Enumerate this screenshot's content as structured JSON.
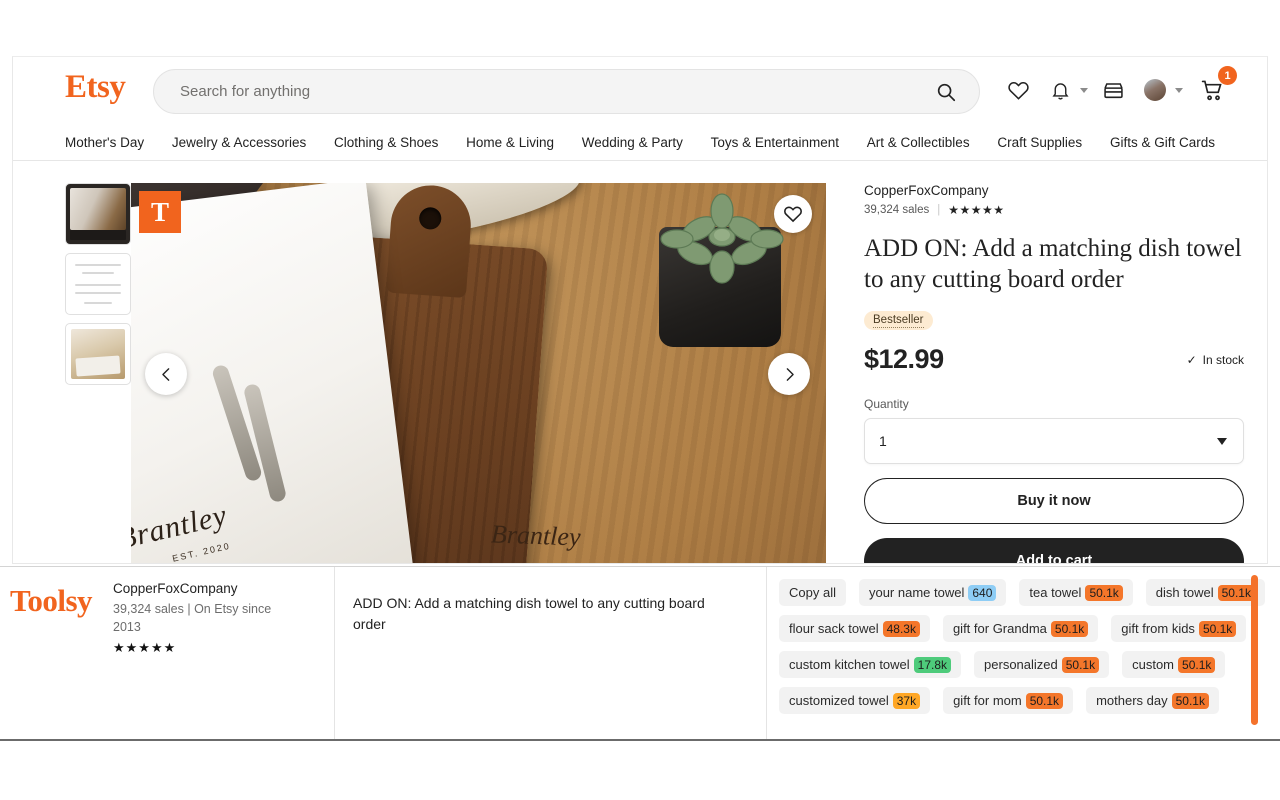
{
  "header": {
    "logo": "Etsy",
    "search_placeholder": "Search for anything",
    "search_value": "",
    "icons": {
      "search": "search-icon",
      "favorites": "heart-icon",
      "notifications": "bell-icon",
      "shop": "storefront-icon",
      "account": "avatar-icon",
      "cart": "cart-icon"
    },
    "cart_count": "1",
    "nav": [
      "Mother's Day",
      "Jewelry & Accessories",
      "Clothing & Shoes",
      "Home & Living",
      "Wedding & Party",
      "Toys & Entertainment",
      "Art & Collectibles",
      "Craft Supplies",
      "Gifts & Gift Cards"
    ]
  },
  "gallery": {
    "overlay_badge": "T",
    "favorite_icon": "heart-icon",
    "prev_icon": "chevron-left-icon",
    "next_icon": "chevron-right-icon",
    "towel_script": "Brantley",
    "towel_est": "EST. 2020",
    "board_script": "Brantley"
  },
  "listing": {
    "shop_name": "CopperFoxCompany",
    "sales": "39,324 sales",
    "divider": "|",
    "stars": "★★★★★",
    "title": "ADD ON: Add a matching dish towel to any cutting board order",
    "badge": "Bestseller",
    "price": "$12.99",
    "stock_check": "✓",
    "stock_text": "In stock",
    "quantity_label": "Quantity",
    "quantity_value": "1",
    "buy_now_label": "Buy it now",
    "add_to_cart_label": "Add to cart"
  },
  "toolsy": {
    "logo": "Toolsy",
    "shop_name": "CopperFoxCompany",
    "shop_meta": "39,324 sales | On Etsy since 2013",
    "stars": "★★★★★",
    "listing_title": "ADD ON: Add a matching dish towel to any cutting board order",
    "copy_all_label": "Copy all",
    "tags": [
      {
        "label": "your name towel",
        "count": "640",
        "color": "#8ecdf5"
      },
      {
        "label": "tea towel",
        "count": "50.1k",
        "color": "#f4762a"
      },
      {
        "label": "dish towel",
        "count": "50.1k",
        "color": "#f4762a"
      },
      {
        "label": "flour sack towel",
        "count": "48.3k",
        "color": "#f4762a"
      },
      {
        "label": "gift for Grandma",
        "count": "50.1k",
        "color": "#f4762a"
      },
      {
        "label": "gift from kids",
        "count": "50.1k",
        "color": "#f4762a"
      },
      {
        "label": "custom kitchen towel",
        "count": "17.8k",
        "color": "#4ecb7b"
      },
      {
        "label": "personalized",
        "count": "50.1k",
        "color": "#f4762a"
      },
      {
        "label": "custom",
        "count": "50.1k",
        "color": "#f4762a"
      },
      {
        "label": "customized towel",
        "count": "37k",
        "color": "#ffa726"
      },
      {
        "label": "gift for mom",
        "count": "50.1k",
        "color": "#f4762a"
      },
      {
        "label": "mothers day",
        "count": "50.1k",
        "color": "#f4762a"
      }
    ]
  },
  "colors": {
    "etsy_orange": "#f1641e",
    "dark": "#222222",
    "chip_bg": "#f2f2f2",
    "bestseller_bg": "#fdebd2"
  }
}
